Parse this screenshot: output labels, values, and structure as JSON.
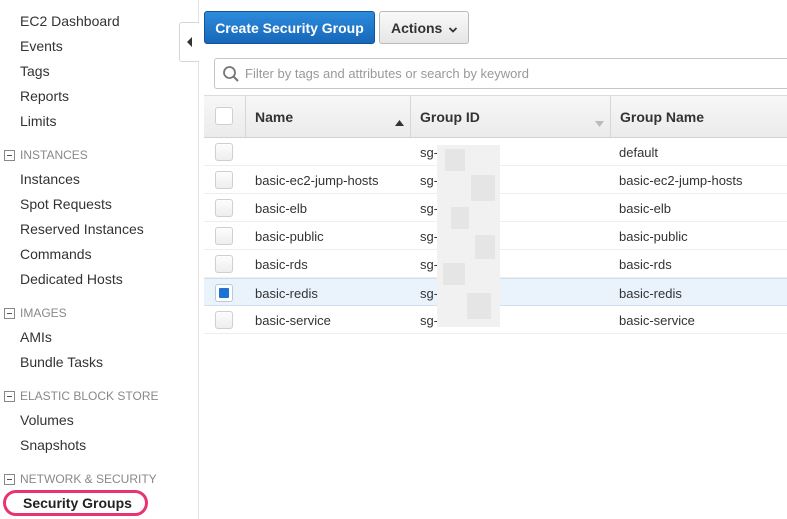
{
  "sidebar": {
    "top_items": [
      "EC2 Dashboard",
      "Events",
      "Tags",
      "Reports",
      "Limits"
    ],
    "sections": [
      {
        "title": "INSTANCES",
        "items": [
          "Instances",
          "Spot Requests",
          "Reserved Instances",
          "Commands",
          "Dedicated Hosts"
        ]
      },
      {
        "title": "IMAGES",
        "items": [
          "AMIs",
          "Bundle Tasks"
        ]
      },
      {
        "title": "ELASTIC BLOCK STORE",
        "items": [
          "Volumes",
          "Snapshots"
        ]
      },
      {
        "title": "NETWORK & SECURITY",
        "items": []
      }
    ],
    "active_item": "Security Groups"
  },
  "toolbar": {
    "create_label": "Create Security Group",
    "actions_label": "Actions"
  },
  "filter": {
    "placeholder": "Filter by tags and attributes or search by keyword"
  },
  "table": {
    "columns": [
      "Name",
      "Group ID",
      "Group Name"
    ],
    "rows": [
      {
        "name": "",
        "group_id": "sg-",
        "group_name": "default",
        "selected": false
      },
      {
        "name": "basic-ec2-jump-hosts",
        "group_id": "sg-",
        "group_name": "basic-ec2-jump-hosts",
        "selected": false
      },
      {
        "name": "basic-elb",
        "group_id": "sg-",
        "group_name": "basic-elb",
        "selected": false
      },
      {
        "name": "basic-public",
        "group_id": "sg-",
        "group_name": "basic-public",
        "selected": false
      },
      {
        "name": "basic-rds",
        "group_id": "sg-",
        "group_name": "basic-rds",
        "selected": false
      },
      {
        "name": "basic-redis",
        "group_id": "sg-",
        "group_name": "basic-redis",
        "selected": true
      },
      {
        "name": "basic-service",
        "group_id": "sg-",
        "group_name": "basic-service",
        "selected": false
      }
    ]
  },
  "colors": {
    "primary": "#1f72cf",
    "highlight_ring": "#e8336e",
    "selected_row": "#eaf3fc"
  },
  "icons": [
    "chevron-left-icon",
    "caret-down-icon",
    "search-icon",
    "sort-asc-icon",
    "sort-desc-icon"
  ]
}
